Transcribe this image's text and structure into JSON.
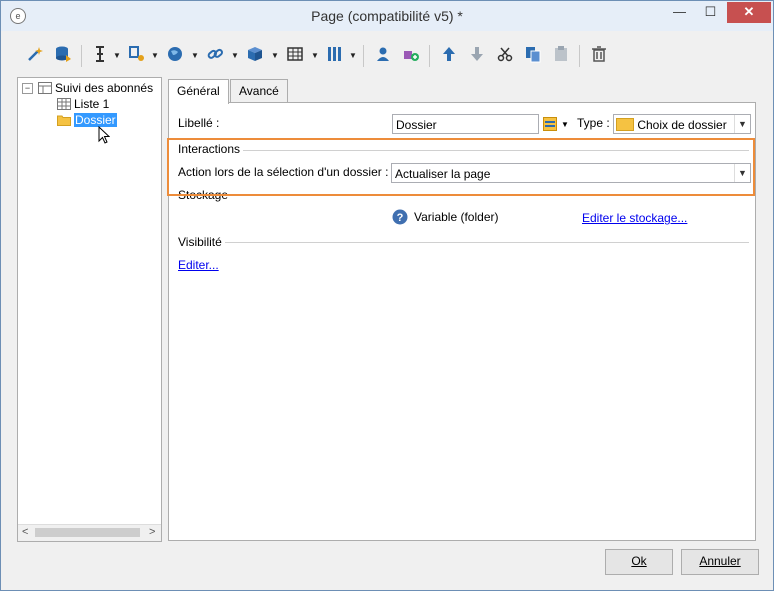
{
  "window": {
    "title": "Page (compatibilité v5) *",
    "controls": {
      "minimize": "—",
      "maximize": "☐",
      "close": "✕"
    }
  },
  "toolbar": {
    "icons": [
      "wand-icon",
      "database-icon",
      "text-cursor-icon",
      "flowchart-icon",
      "globe-icon",
      "link-icon",
      "box-icon",
      "table-icon",
      "columns-icon",
      "person-icon",
      "add-entity-icon",
      "arrow-up-icon",
      "arrow-down-icon",
      "cut-icon",
      "copy-icon",
      "paste-icon",
      "trash-icon"
    ]
  },
  "tree": {
    "root": {
      "label": "Suivi des abonnés",
      "expander": "−"
    },
    "children": [
      {
        "label": "Liste 1",
        "icon": "grid-icon"
      },
      {
        "label": "Dossier",
        "icon": "folder-icon",
        "selected": true
      }
    ]
  },
  "tabs": [
    {
      "label": "Général",
      "active": true
    },
    {
      "label": "Avancé",
      "active": false
    }
  ],
  "form": {
    "libelle_label": "Libellé :",
    "libelle_value": "Dossier",
    "type_label": "Type :",
    "type_value": "Choix de dossier",
    "interactions_title": "Interactions",
    "action_label": "Action lors de la sélection d'un dossier :",
    "action_value": "Actualiser la page",
    "stockage_title": "Stockage",
    "variable_text": "Variable (folder)",
    "edit_storage_link": "Editer le stockage...",
    "visibilite_title": "Visibilité",
    "edit_visibility_link": "Editer..."
  },
  "buttons": {
    "ok": "Ok",
    "cancel": "Annuler"
  },
  "colors": {
    "highlight": "#ed8c3a",
    "close": "#c75050",
    "selection": "#3399ff",
    "folder": "#f5c242"
  }
}
